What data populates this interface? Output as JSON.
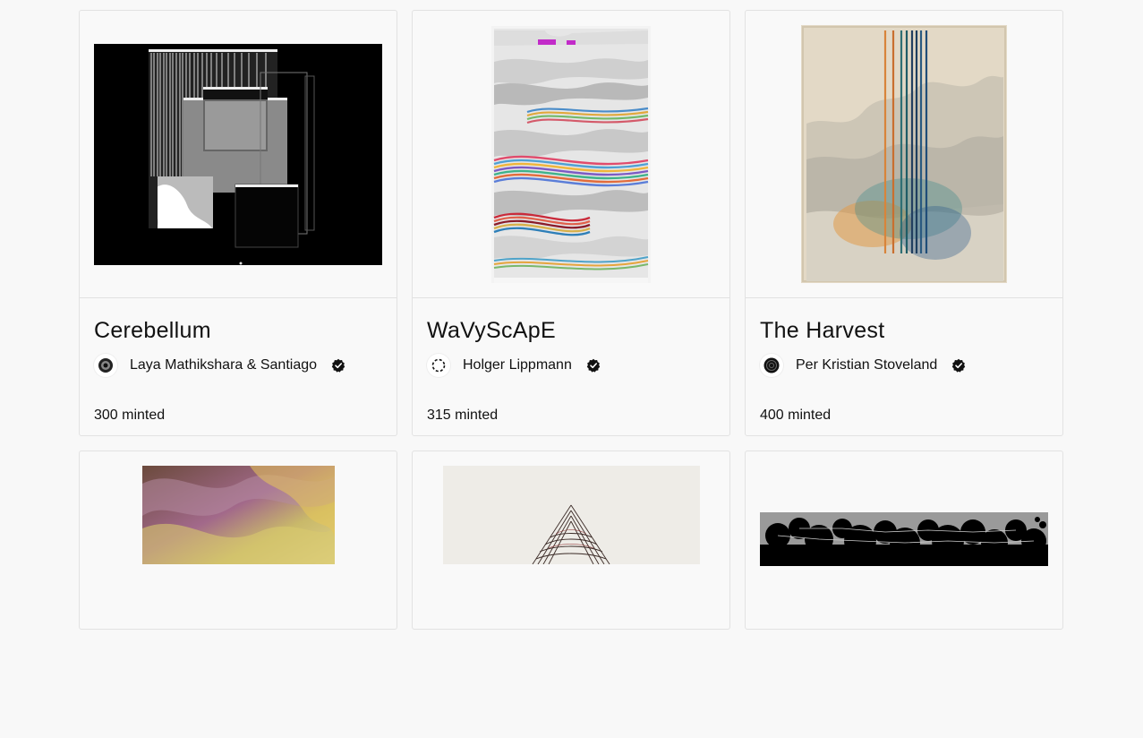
{
  "projects": [
    {
      "title": "Cerebellum",
      "artist": "Laya Mathikshara & Santiago",
      "minted": "300 minted",
      "verified": true
    },
    {
      "title": "WaVyScApE",
      "artist": "Holger Lippmann",
      "minted": "315 minted",
      "verified": true
    },
    {
      "title": "The Harvest",
      "artist": "Per Kristian Stoveland",
      "minted": "400 minted",
      "verified": true
    }
  ],
  "colors": {
    "background": "#f8f8f8",
    "card_border": "#e2e2e2",
    "text": "#111111",
    "verified_badge": "#111111"
  },
  "icons": {
    "verified": "verified-check-icon"
  }
}
